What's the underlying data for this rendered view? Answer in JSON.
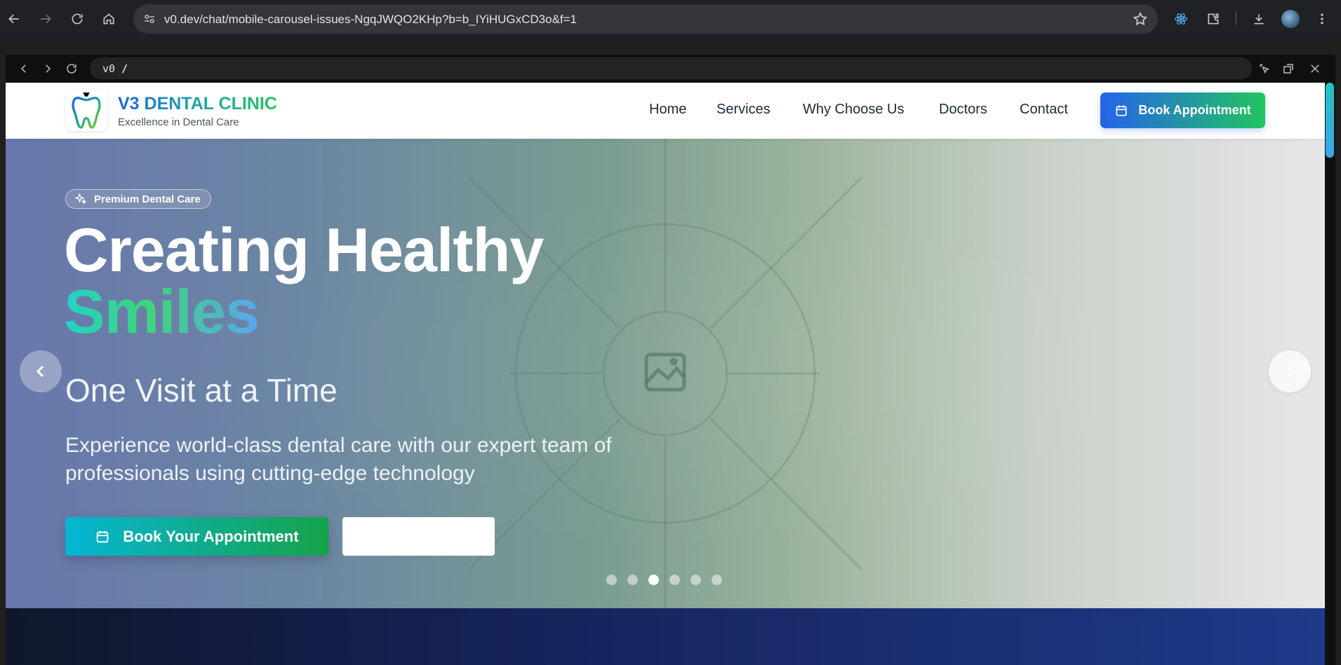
{
  "browser": {
    "url": "v0.dev/chat/mobile-carousel-issues-NgqJWQO2KHp?b=b_IYiHUGxCD3o&f=1"
  },
  "preview": {
    "logo": "v0",
    "path": "/"
  },
  "header": {
    "brand_name": "V3 DENTAL CLINIC",
    "brand_tagline": "Excellence in Dental Care",
    "nav": [
      "Home",
      "Services",
      "Why Choose Us",
      "Doctors",
      "Contact"
    ],
    "book_button": "Book Appointment"
  },
  "hero": {
    "badge": "Premium Dental Care",
    "title_line1": "Creating Healthy",
    "title_line2": "Smiles",
    "subtitle": "One Visit at a Time",
    "description": "Experience world-class dental care with our expert team of professionals using cutting-edge technology",
    "cta_primary": "Book Your Appointment",
    "cta_secondary": "",
    "slides": 6,
    "active_slide": 3
  },
  "colors": {
    "brand_blue": "#2563eb",
    "brand_green": "#22c55e",
    "cta_cyan": "#06b6d4"
  }
}
